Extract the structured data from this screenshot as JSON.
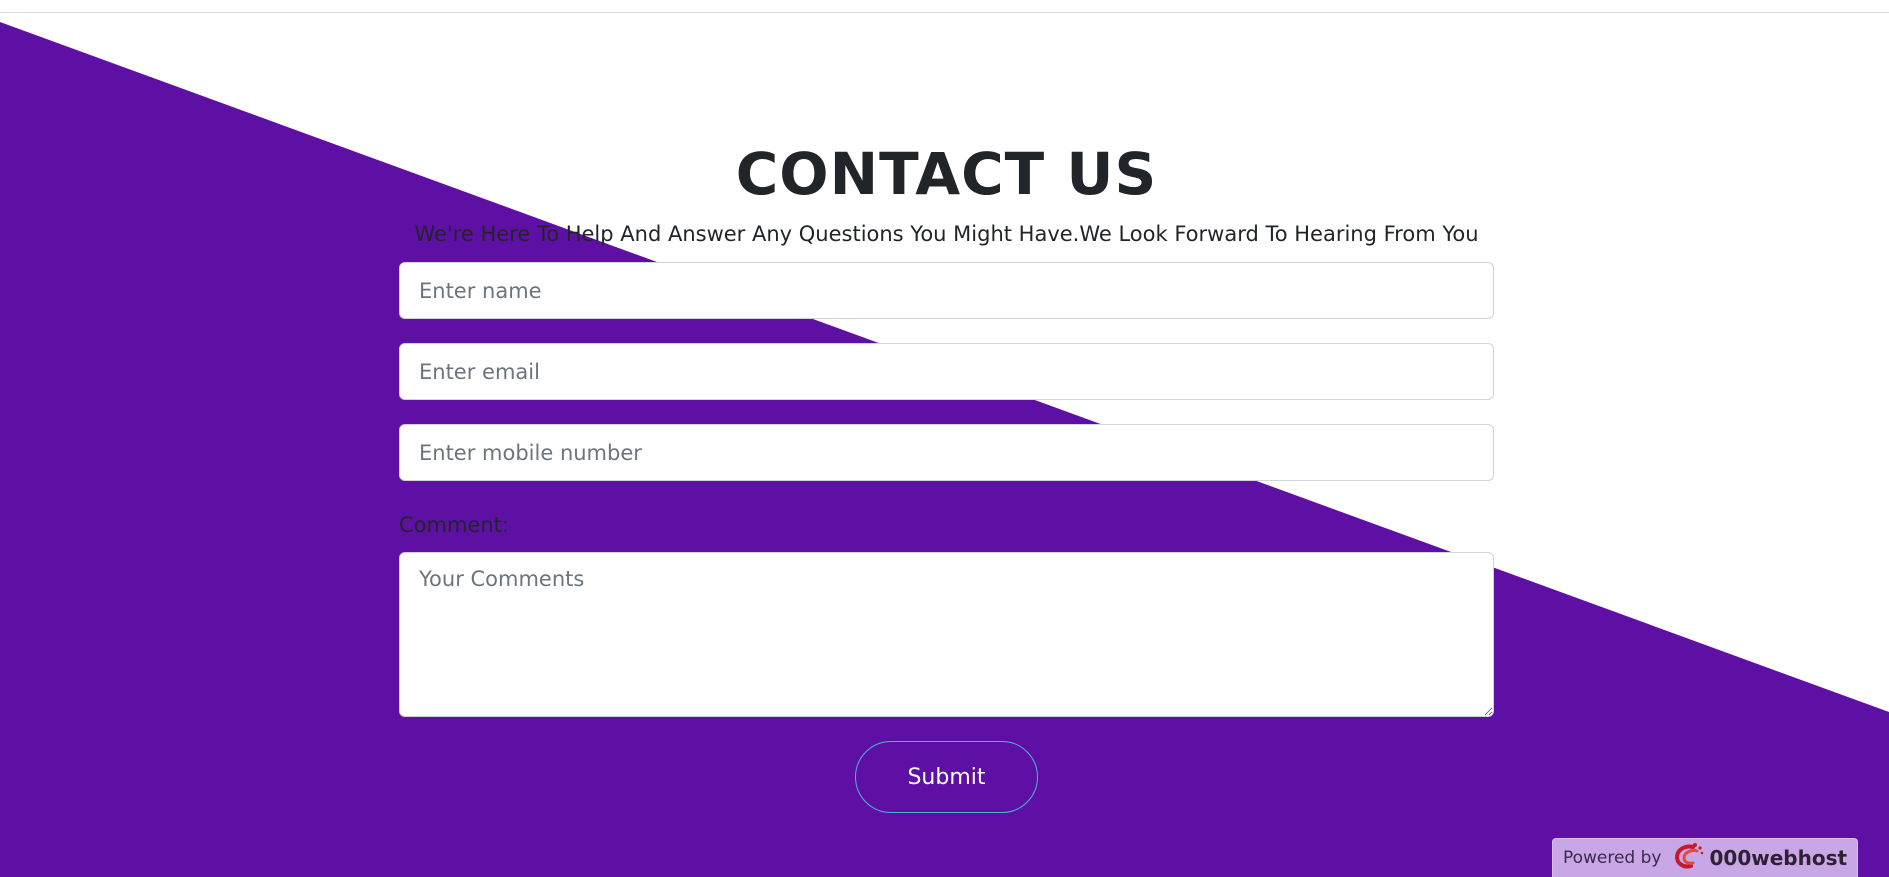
{
  "colors": {
    "background": "#ffffff",
    "diagonal": "#5f10a4",
    "text": "#212529",
    "placeholder": "#6c757d",
    "button_border": "#4fb3d4",
    "powered_bg": "#c9a6e6"
  },
  "contact": {
    "title": "CONTACT US",
    "subtitle": "We're Here To Help And Answer Any Questions You Might Have.We Look Forward To Hearing From You",
    "name_placeholder": "Enter name",
    "email_placeholder": "Enter email",
    "mobile_placeholder": "Enter mobile number",
    "comment_label": "Comment:",
    "comment_placeholder": "Your Comments",
    "submit_label": "Submit"
  },
  "footer": {
    "powered_by": "Powered by",
    "brand_name": "000webhost",
    "brand_icon": "000webhost-logo-icon"
  }
}
